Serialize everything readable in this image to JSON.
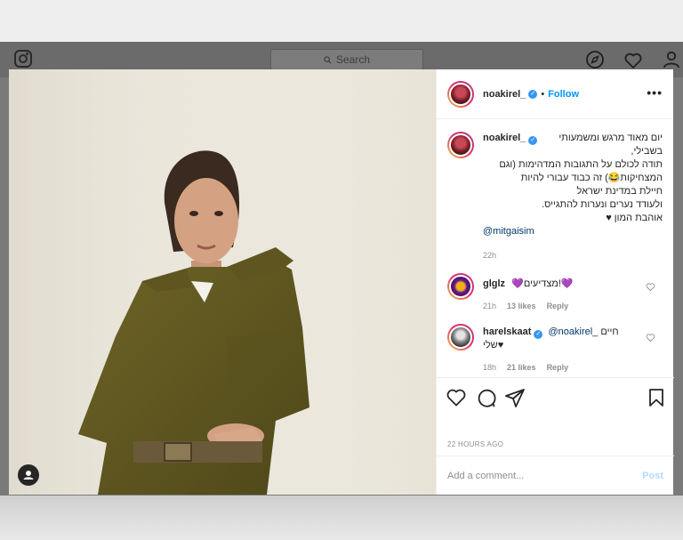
{
  "nav": {
    "search_placeholder": "Search"
  },
  "post": {
    "author": "noakirel_",
    "follow_label": "Follow",
    "dot": "•",
    "more_label": "•••",
    "caption": {
      "user": "noakirel_",
      "lines": [
        "יום מאוד מרגש ומשמעותי",
        "בשבילי,",
        "תודה לכולם על התגובות המדהימות (וגם",
        "המצחיקות😂) זה כבוד עבורי להיות",
        "חיילת במדינת ישראל",
        "ולעודד נערים ונערות להתגייס.",
        "אוהבת המון ♥"
      ],
      "mention": "@mitgaisim",
      "time": "22h"
    },
    "comments": [
      {
        "user": "glglz",
        "text": "💜מצדיעים!💜",
        "time": "21h",
        "likes": "13 likes",
        "reply": "Reply"
      },
      {
        "user": "harelskaat",
        "mention": "@noakirel_",
        "text": "חיים",
        "text2": "שלי♥",
        "time": "18h",
        "likes": "21 likes",
        "reply": "Reply"
      }
    ],
    "timestamp": "22 HOURS AGO",
    "add_comment_placeholder": "Add a comment...",
    "post_label": "Post"
  },
  "icons": {
    "logo": "instagram-logo-icon",
    "search": "search-icon",
    "explore": "compass-icon",
    "activity": "heart-icon",
    "profile": "user-icon",
    "like": "heart-outline-icon",
    "comment": "comment-icon",
    "share": "paper-plane-icon",
    "save": "bookmark-icon",
    "tag": "user-tag-icon"
  },
  "colors": {
    "accent": "#0095f6",
    "verified": "#3897f0",
    "muted": "#8e8e8e"
  }
}
